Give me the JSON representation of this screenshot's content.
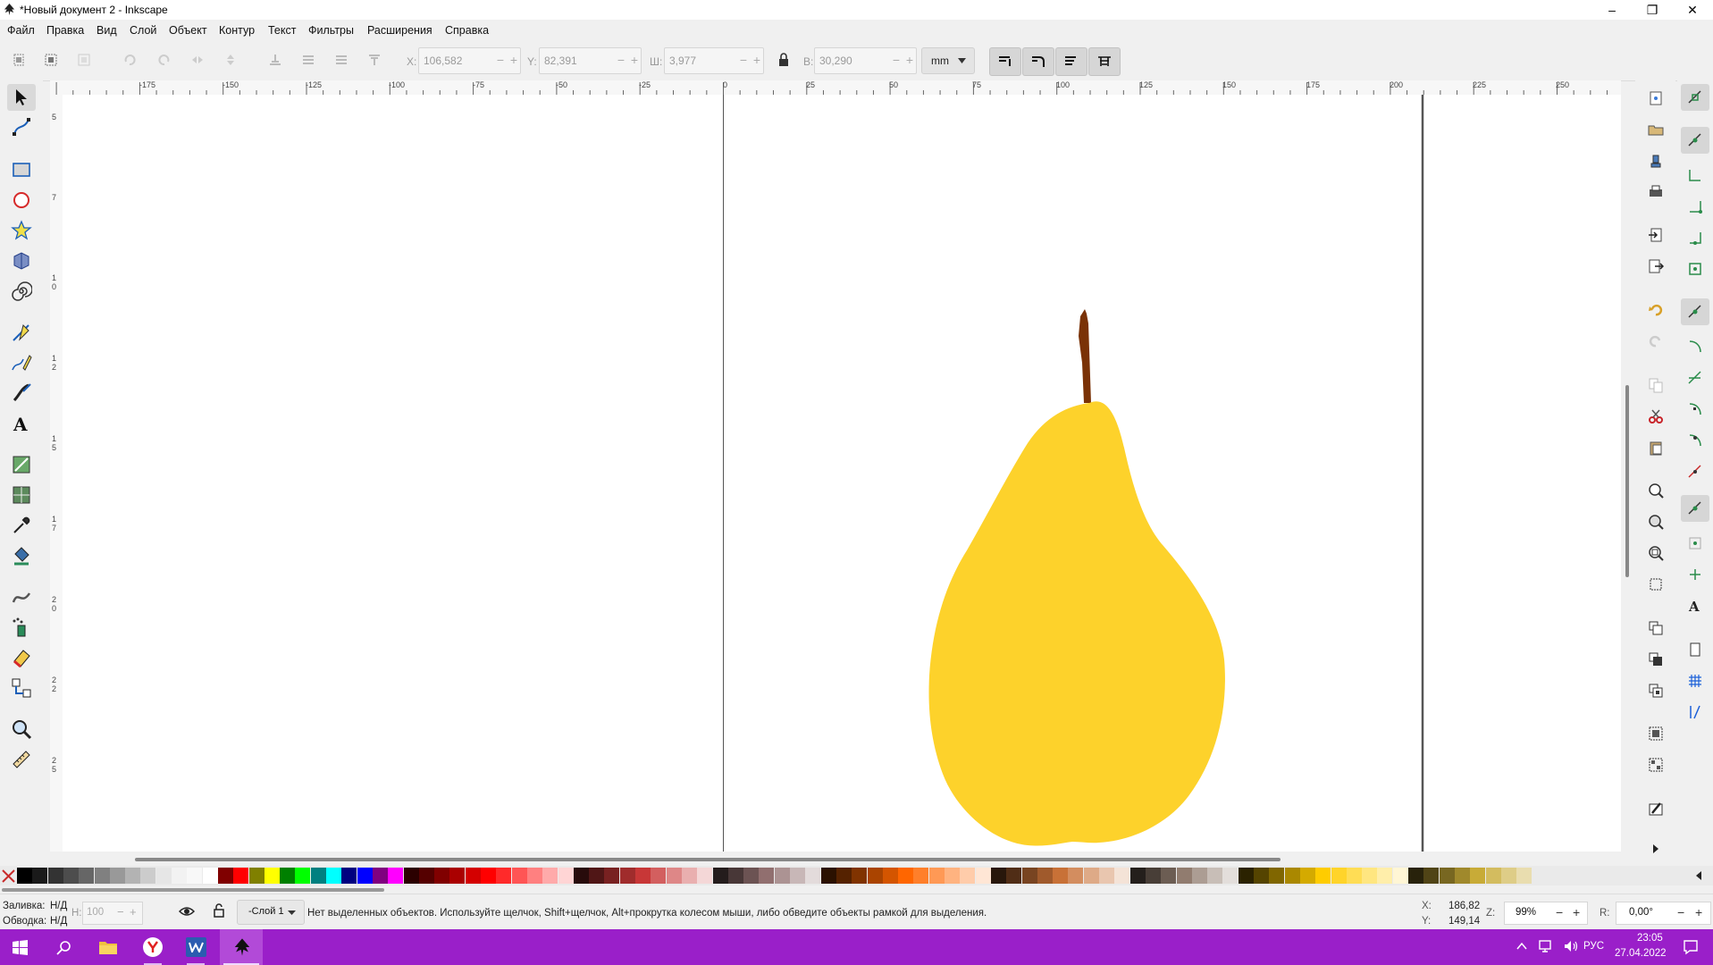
{
  "window": {
    "title": "*Новый документ 2 - Inkscape"
  },
  "menu": [
    "Файл",
    "Правка",
    "Вид",
    "Слой",
    "Объект",
    "Контур",
    "Текст",
    "Фильтры",
    "Расширения",
    "Справка"
  ],
  "toolbar": {
    "x_label": "X:",
    "x_value": "106,582",
    "y_label": "Y:",
    "y_value": "82,391",
    "w_label": "Ш:",
    "w_value": "3,977",
    "h_label": "В:",
    "h_value": "30,290",
    "unit": "mm",
    "minus": "−",
    "plus": "+"
  },
  "ruler": {
    "h_ticks": [
      "-175",
      "-150",
      "-125",
      "-100",
      "-75",
      "-50",
      "-25",
      "0",
      "25",
      "50",
      "75",
      "100",
      "125",
      "150",
      "175",
      "200",
      "225",
      "250"
    ],
    "v_ticks": [
      "5",
      "7",
      "1 0",
      "1 2",
      "1 5",
      "1 7",
      "2 0",
      "2 2",
      "2 5"
    ]
  },
  "palette": {
    "colors": [
      "#000000",
      "#1a1a1a",
      "#333333",
      "#4d4d4d",
      "#666666",
      "#808080",
      "#999999",
      "#b3b3b3",
      "#cccccc",
      "#e6e6e6",
      "#f2f2f2",
      "#f8f8f8",
      "#ffffff",
      "#800000",
      "#ff0000",
      "#808000",
      "#ffff00",
      "#008000",
      "#00ff00",
      "#008080",
      "#00ffff",
      "#000080",
      "#0000ff",
      "#800080",
      "#ff00ff",
      "#2b0000",
      "#550000",
      "#800000",
      "#aa0000",
      "#d40000",
      "#ff0000",
      "#ff2a2a",
      "#ff5555",
      "#ff8080",
      "#ffaaaa",
      "#ffd5d5",
      "#280b0b",
      "#501616",
      "#782121",
      "#a02c2c",
      "#c83737",
      "#d35f5f",
      "#de8787",
      "#e9afaf",
      "#f4d7d7",
      "#241c1c",
      "#483737",
      "#6c5353",
      "#916f6f",
      "#ac9393",
      "#c8b7b7",
      "#e3dbdb",
      "#2b1100",
      "#552200",
      "#803300",
      "#aa4400",
      "#d45500",
      "#ff6600",
      "#ff7f2a",
      "#ff9955",
      "#ffb380",
      "#ffccaa",
      "#ffe6d5",
      "#28170b",
      "#502d16",
      "#784421",
      "#a05a2c",
      "#c87137",
      "#d38d5f",
      "#deaa87",
      "#e9c6af",
      "#f4e3d7",
      "#241f1c",
      "#483e37",
      "#6c5d53",
      "#917c6f",
      "#ac9d93",
      "#c8beb7",
      "#e3dedb",
      "#2b2200",
      "#554400",
      "#806600",
      "#aa8800",
      "#d4aa00",
      "#ffcc00",
      "#ffd42a",
      "#ffdd55",
      "#ffe680",
      "#ffeeaa",
      "#fff6d5",
      "#28220b",
      "#504416",
      "#786721",
      "#a0892c",
      "#c8ab37",
      "#d3bc5f",
      "#decd87",
      "#e9ddaf"
    ]
  },
  "status": {
    "fill_label": "Заливка:",
    "fill_value": "Н/Д",
    "stroke_label": "Обводка:",
    "stroke_value": "Н/Д",
    "opacity_label": "Н:",
    "opacity_value": "100",
    "layer": "-Слой 1",
    "message": "Нет выделенных объектов. Используйте щелчок, Shift+щелчок, Alt+прокрутка колесом мыши, либо обведите объекты рамкой для выделения.",
    "cursor_x_label": "X:",
    "cursor_x": "186,82",
    "cursor_y_label": "Y:",
    "cursor_y": "149,14",
    "zoom_label": "Z:",
    "zoom": "99%",
    "rotate_label": "R:",
    "rotate": "0,00°"
  },
  "taskbar": {
    "lang": "РУС",
    "time": "23:05",
    "date": "27.04.2022"
  },
  "colors": {
    "pear": "#fdd22b",
    "stem": "#7a3206",
    "taskbar": "#9a1fc9"
  }
}
